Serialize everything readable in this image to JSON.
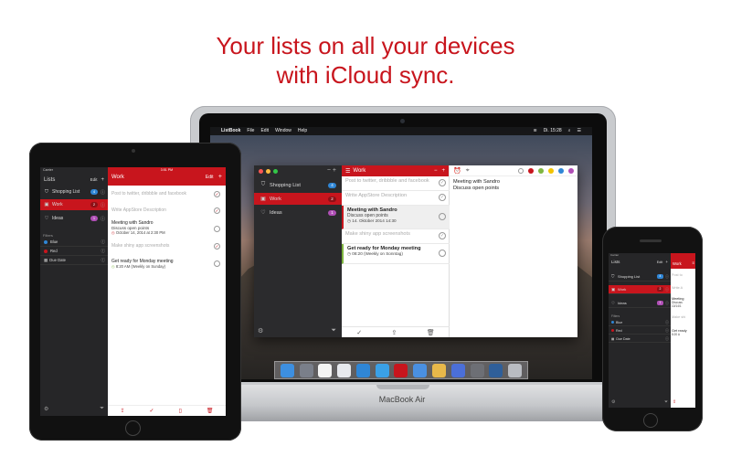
{
  "headline": {
    "line1": "Your lists on all your devices",
    "line2": "with iCloud sync."
  },
  "colors": {
    "accent": "#c8151d",
    "sidebar": "#262628"
  },
  "mac": {
    "laptop_label": "MacBook Air",
    "menubar": {
      "app": "ListBook",
      "items": [
        "File",
        "Edit",
        "Window",
        "Help"
      ],
      "clock": "Di. 15:28"
    },
    "sidebar": {
      "items": [
        {
          "icon": "shopping-bag-icon",
          "label": "Shopping List",
          "badge": "4",
          "badge_color": "#2f86d6",
          "selected": false
        },
        {
          "icon": "briefcase-icon",
          "label": "Work",
          "badge": "2",
          "badge_color": "#8e1016",
          "selected": true
        },
        {
          "icon": "heart-icon",
          "label": "Ideas",
          "badge": "1",
          "badge_color": "#b04fb6",
          "selected": false
        }
      ]
    },
    "list": {
      "title": "Work",
      "tasks": [
        {
          "title": "Post to twitter, dribbble and facebook",
          "done": true
        },
        {
          "title": "Write AppStore Description",
          "done": true
        },
        {
          "title": "Meeting with Sandro",
          "note": "Discuss open points",
          "date": "14. Oktober 2014 14:30",
          "done": false,
          "selected": true
        },
        {
          "title": "Make shiny app screenshots",
          "done": true
        },
        {
          "title": "Get ready for Monday meeting",
          "date": "08:20 (Weekly on Sonntag)",
          "done": false
        }
      ]
    },
    "detail": {
      "title": "Meeting with Sandro",
      "note": "Discuss open points",
      "colors": [
        "#ffffff",
        "#c8151d",
        "#7fb640",
        "#f2c300",
        "#2f86d6",
        "#b04fb6"
      ]
    }
  },
  "ipad": {
    "status_left": "Carrier",
    "status_time": "3:51 PM",
    "sidebar": {
      "title": "Lists",
      "edit": "Edit",
      "items": [
        {
          "icon": "shopping-bag-icon",
          "label": "Shopping List",
          "badge": "4",
          "badge_color": "#2f86d6",
          "selected": false
        },
        {
          "icon": "briefcase-icon",
          "label": "Work",
          "badge": "2",
          "badge_color": "#8e1016",
          "selected": true
        },
        {
          "icon": "heart-icon",
          "label": "Ideas",
          "badge": "1",
          "badge_color": "#b04fb6",
          "selected": false
        }
      ],
      "filters_header": "Filters",
      "filters": [
        {
          "label": "Blue",
          "color": "#2f86d6"
        },
        {
          "label": "Red",
          "color": "#c8151d"
        },
        {
          "label": "Due Date",
          "color": ""
        }
      ]
    },
    "list": {
      "title": "Work",
      "edit": "Edit",
      "tasks": [
        {
          "title": "Post to twitter, dribbble and facebook",
          "done": true
        },
        {
          "title": "Write AppStore Description",
          "done": true
        },
        {
          "title": "Meeting with Sandro",
          "note": "Discuss open points",
          "date": "October 14, 2014 at 2:30 PM",
          "done": false
        },
        {
          "title": "Make shiny app screenshots",
          "done": true
        },
        {
          "title": "Get ready for Monday meeting",
          "date": "8:20 AM (Weekly on Sunday)",
          "done": false
        }
      ]
    }
  },
  "iphone": {
    "status_left": "Carrier",
    "sidebar": {
      "title": "Lists",
      "edit": "Edit",
      "items": [
        {
          "label": "Shopping List",
          "badge": "4",
          "badge_color": "#2f86d6",
          "selected": false
        },
        {
          "label": "Work",
          "badge": "2",
          "badge_color": "#8e1016",
          "selected": true
        },
        {
          "label": "Ideas",
          "badge": "1",
          "badge_color": "#b04fb6",
          "selected": false
        }
      ],
      "filters_header": "Filters",
      "filters": [
        {
          "label": "Blue",
          "color": "#2f86d6"
        },
        {
          "label": "Red",
          "color": "#c8151d"
        },
        {
          "label": "Due Date",
          "color": ""
        }
      ]
    },
    "list": {
      "title": "Work",
      "tasks": [
        {
          "title": "Post to",
          "done": true
        },
        {
          "title": "Write A",
          "done": true
        },
        {
          "title": "Meeting",
          "note": "Discuss",
          "date": "10/14/1",
          "done": false
        },
        {
          "title": "Make shi",
          "done": true
        },
        {
          "title": "Get ready",
          "date": "8:20 A",
          "done": false
        }
      ]
    }
  }
}
